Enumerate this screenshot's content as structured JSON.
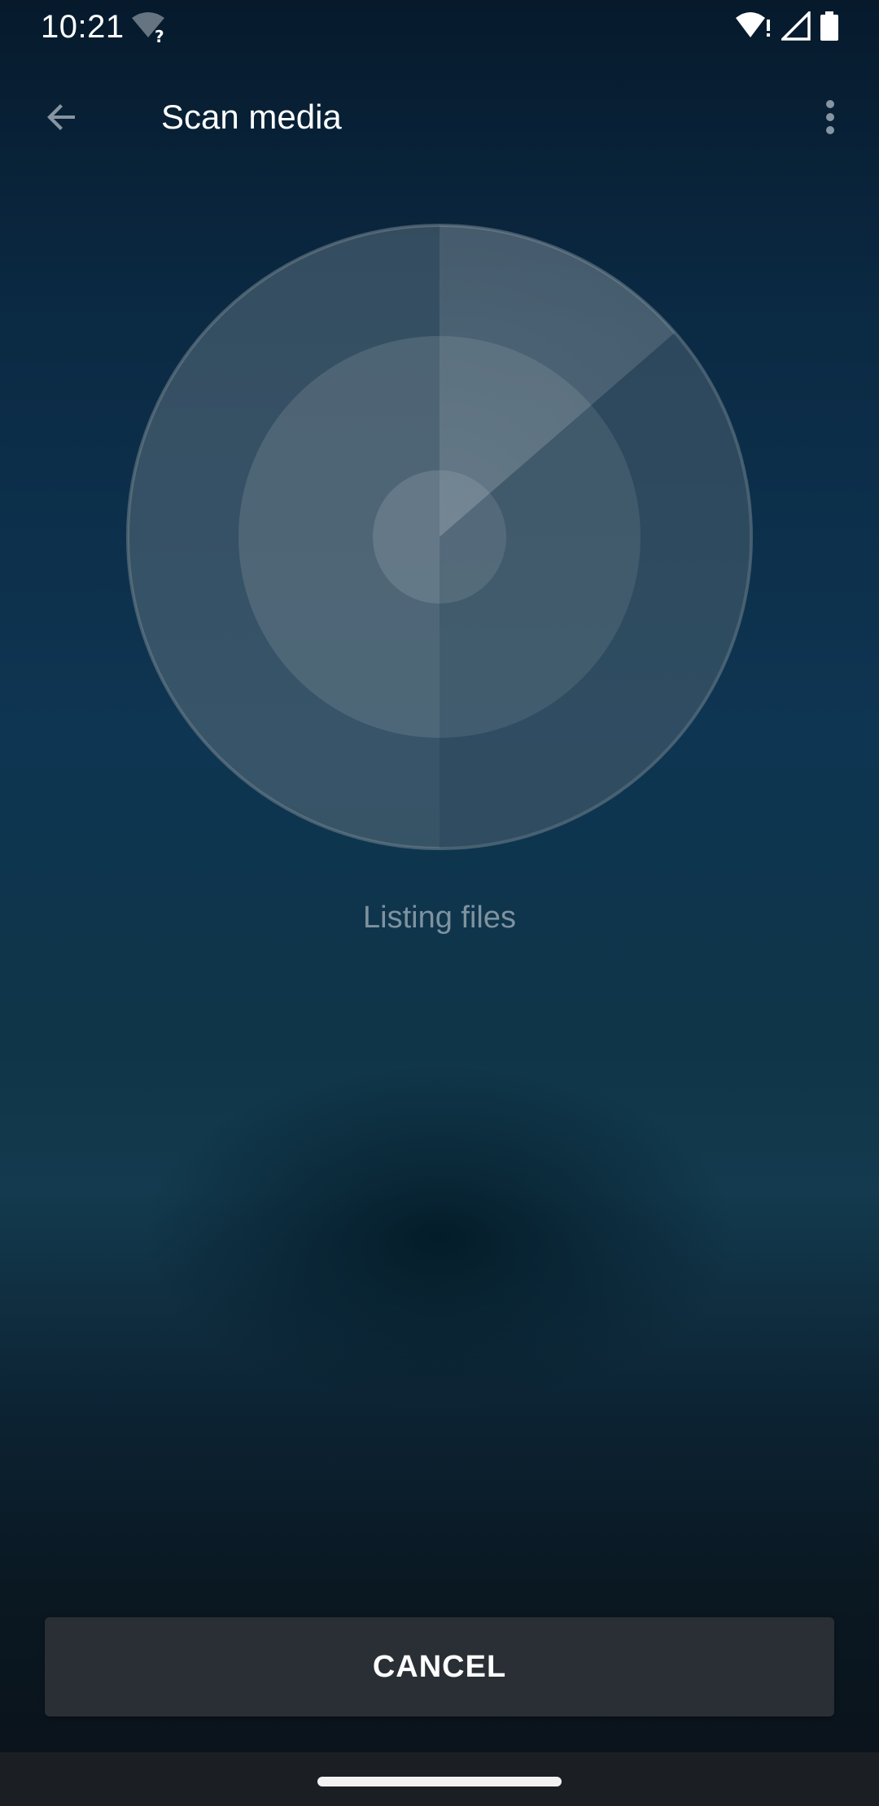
{
  "status_bar": {
    "time": "10:21",
    "icons": [
      "wifi-unknown-icon",
      "wifi-alert-icon",
      "cell-signal-icon",
      "battery-icon"
    ]
  },
  "app_bar": {
    "title": "Scan media",
    "back_icon": "arrow-back-icon",
    "menu_icon": "more-vert-icon"
  },
  "scan": {
    "status": "Listing files"
  },
  "actions": {
    "cancel_label": "CANCEL"
  },
  "colors": {
    "background_top": "#061a2c",
    "background_bottom": "#0b121a",
    "button": "#2a2f35",
    "status_text": "#7f929f"
  }
}
